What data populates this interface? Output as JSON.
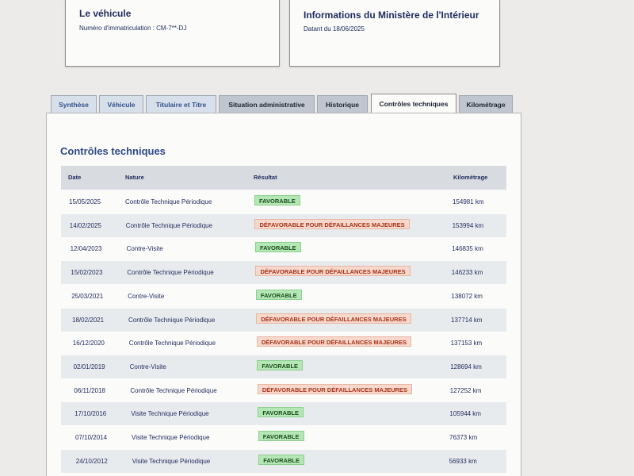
{
  "vehicle_card": {
    "title": "Le véhicule",
    "registration": "Numéro d'immatriculation : CM-7**-DJ"
  },
  "ministry_card": {
    "title": "Informations du Ministère de l'Intérieur",
    "date_line": "Datant du 18/06/2025"
  },
  "tabs": [
    {
      "label": "Synthèse",
      "state": "inactive"
    },
    {
      "label": "Véhicule",
      "state": "inactive"
    },
    {
      "label": "Titulaire et Titre",
      "state": "inactive"
    },
    {
      "label": "Situation administrative",
      "state": "inactive"
    },
    {
      "label": "Historique",
      "state": "inactive"
    },
    {
      "label": "Contrôles techniques",
      "state": "active"
    },
    {
      "label": "Kilométrage",
      "state": "inactive"
    }
  ],
  "section": {
    "title": "Contrôles techniques"
  },
  "table": {
    "columns": [
      "Date",
      "Nature",
      "Résultat",
      "Kilométrage"
    ],
    "rows": [
      {
        "date": "15/05/2025",
        "nature": "Contrôle Technique Périodique",
        "result": "FAVORABLE",
        "status": "ok",
        "km": "154981 km"
      },
      {
        "date": "14/02/2025",
        "nature": "Contrôle Technique Périodique",
        "result": "DÉFAVORABLE POUR DÉFAILLANCES MAJEURES",
        "status": "ko",
        "km": "153994 km"
      },
      {
        "date": "12/04/2023",
        "nature": "Contre-Visite",
        "result": "FAVORABLE",
        "status": "ok",
        "km": "146835 km"
      },
      {
        "date": "15/02/2023",
        "nature": "Contrôle Technique Périodique",
        "result": "DÉFAVORABLE POUR DÉFAILLANCES MAJEURES",
        "status": "ko",
        "km": "146233 km"
      },
      {
        "date": "25/03/2021",
        "nature": "Contre-Visite",
        "result": "FAVORABLE",
        "status": "ok",
        "km": "138072 km"
      },
      {
        "date": "18/02/2021",
        "nature": "Contrôle Technique Périodique",
        "result": "DÉFAVORABLE POUR DÉFAILLANCES MAJEURES",
        "status": "ko",
        "km": "137714 km"
      },
      {
        "date": "16/12/2020",
        "nature": "Contrôle Technique Périodique",
        "result": "DÉFAVORABLE POUR DÉFAILLANCES MAJEURES",
        "status": "ko",
        "km": "137153 km"
      },
      {
        "date": "02/01/2019",
        "nature": "Contre-Visite",
        "result": "FAVORABLE",
        "status": "ok",
        "km": "128694 km"
      },
      {
        "date": "06/11/2018",
        "nature": "Contrôle Technique Périodique",
        "result": "DÉFAVORABLE POUR DÉFAILLANCES MAJEURES",
        "status": "ko",
        "km": "127252 km"
      },
      {
        "date": "17/10/2016",
        "nature": "Visite Technique Périodique",
        "result": "FAVORABLE",
        "status": "ok",
        "km": "105944 km"
      },
      {
        "date": "07/10/2014",
        "nature": "Visite Technique Périodique",
        "result": "FAVORABLE",
        "status": "ok",
        "km": "76373 km"
      },
      {
        "date": "24/10/2012",
        "nature": "Visite Technique Périodique",
        "result": "FAVORABLE",
        "status": "ok",
        "km": "56933 km"
      }
    ]
  },
  "colors": {
    "accent": "#2e4a88",
    "favorable": "#b5e6b5",
    "defavorable": "#f6d8cc"
  }
}
